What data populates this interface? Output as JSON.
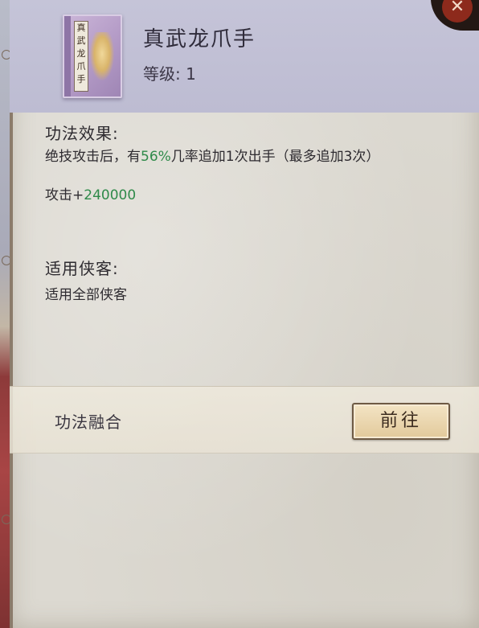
{
  "skill": {
    "name": "真武龙爪手",
    "book_label": "真武龙爪手",
    "level_label": "等级:",
    "level_value": "1"
  },
  "effect": {
    "title": "功法效果:",
    "line1_prefix": "绝技攻击后，有",
    "line1_percent": "56%",
    "line1_suffix": "几率追加1次出手（最多追加3次）",
    "line2_prefix": "攻击+",
    "line2_value": "240000"
  },
  "applicable": {
    "title": "适用侠客:",
    "text": "适用全部侠客"
  },
  "fusion": {
    "label": "功法融合",
    "goto_button": "前往"
  },
  "colors": {
    "header_bg": "#c5c4d8",
    "parchment_bg": "#dcd9d1",
    "highlight_green": "#2f8a4a",
    "button_bg": "#e8d3a8",
    "close_red": "#8d2a1c"
  },
  "icons": {
    "close": "close-icon",
    "book": "skill-book-icon"
  }
}
